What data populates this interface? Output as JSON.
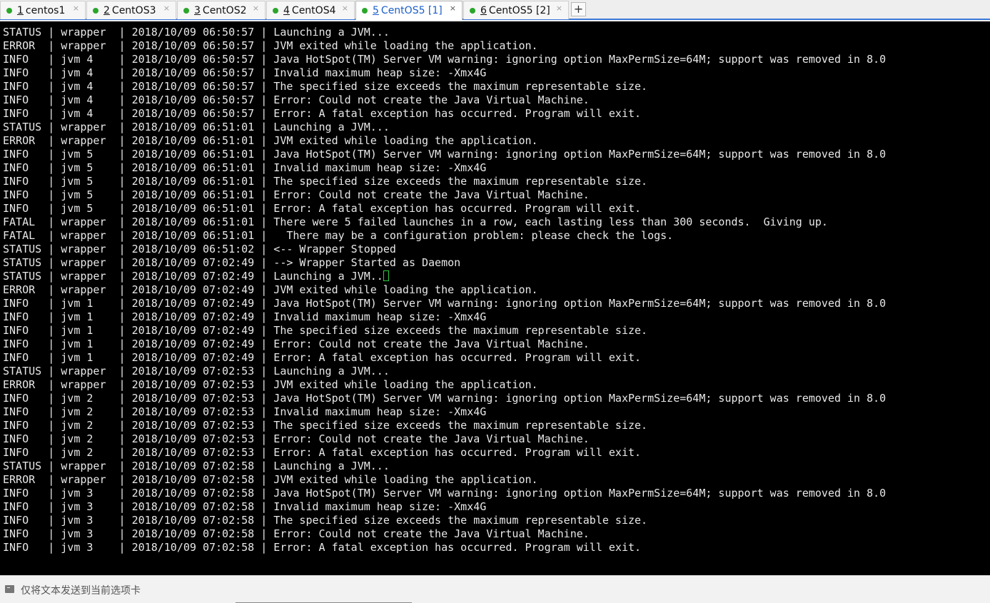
{
  "tabs": [
    {
      "num": "1",
      "label": "centos1",
      "status_color": "#2aa62a",
      "close": "×",
      "active": false
    },
    {
      "num": "2",
      "label": "CentOS3",
      "status_color": "#2aa62a",
      "close": "×",
      "active": false
    },
    {
      "num": "3",
      "label": "CentOS2",
      "status_color": "#2aa62a",
      "close": "×",
      "active": false
    },
    {
      "num": "4",
      "label": "CentOS4",
      "status_color": "#2aa62a",
      "close": "×",
      "active": false
    },
    {
      "num": "5",
      "label": "CentOS5 [1]",
      "status_color": "#2aa62a",
      "close": "×",
      "active": true
    },
    {
      "num": "6",
      "label": "CentOS5 [2]",
      "status_color": "#2aa62a",
      "close": "×",
      "active": false
    }
  ],
  "add_tab_label": "+",
  "colors": {
    "terminal_bg": "#000000",
    "terminal_fg": "#e8e8e8",
    "active_tab_text": "#1a5fc8",
    "tab_underline": "#3c78d8",
    "cursor": "#2ecc40"
  },
  "terminal": {
    "lines": [
      "STATUS | wrapper  | 2018/10/09 06:50:57 | Launching a JVM...",
      "ERROR  | wrapper  | 2018/10/09 06:50:57 | JVM exited while loading the application.",
      "INFO   | jvm 4    | 2018/10/09 06:50:57 | Java HotSpot(TM) Server VM warning: ignoring option MaxPermSize=64M; support was removed in 8.0",
      "INFO   | jvm 4    | 2018/10/09 06:50:57 | Invalid maximum heap size: -Xmx4G",
      "INFO   | jvm 4    | 2018/10/09 06:50:57 | The specified size exceeds the maximum representable size.",
      "INFO   | jvm 4    | 2018/10/09 06:50:57 | Error: Could not create the Java Virtual Machine.",
      "INFO   | jvm 4    | 2018/10/09 06:50:57 | Error: A fatal exception has occurred. Program will exit.",
      "STATUS | wrapper  | 2018/10/09 06:51:01 | Launching a JVM...",
      "ERROR  | wrapper  | 2018/10/09 06:51:01 | JVM exited while loading the application.",
      "INFO   | jvm 5    | 2018/10/09 06:51:01 | Java HotSpot(TM) Server VM warning: ignoring option MaxPermSize=64M; support was removed in 8.0",
      "INFO   | jvm 5    | 2018/10/09 06:51:01 | Invalid maximum heap size: -Xmx4G",
      "INFO   | jvm 5    | 2018/10/09 06:51:01 | The specified size exceeds the maximum representable size.",
      "INFO   | jvm 5    | 2018/10/09 06:51:01 | Error: Could not create the Java Virtual Machine.",
      "INFO   | jvm 5    | 2018/10/09 06:51:01 | Error: A fatal exception has occurred. Program will exit.",
      "FATAL  | wrapper  | 2018/10/09 06:51:01 | There were 5 failed launches in a row, each lasting less than 300 seconds.  Giving up.",
      "FATAL  | wrapper  | 2018/10/09 06:51:01 |   There may be a configuration problem: please check the logs.",
      "STATUS | wrapper  | 2018/10/09 06:51:02 | <-- Wrapper Stopped",
      "STATUS | wrapper  | 2018/10/09 07:02:49 | --> Wrapper Started as Daemon",
      "STATUS | wrapper  | 2018/10/09 07:02:49 | Launching a JVM..",
      "ERROR  | wrapper  | 2018/10/09 07:02:49 | JVM exited while loading the application.",
      "INFO   | jvm 1    | 2018/10/09 07:02:49 | Java HotSpot(TM) Server VM warning: ignoring option MaxPermSize=64M; support was removed in 8.0",
      "INFO   | jvm 1    | 2018/10/09 07:02:49 | Invalid maximum heap size: -Xmx4G",
      "INFO   | jvm 1    | 2018/10/09 07:02:49 | The specified size exceeds the maximum representable size.",
      "INFO   | jvm 1    | 2018/10/09 07:02:49 | Error: Could not create the Java Virtual Machine.",
      "INFO   | jvm 1    | 2018/10/09 07:02:49 | Error: A fatal exception has occurred. Program will exit.",
      "STATUS | wrapper  | 2018/10/09 07:02:53 | Launching a JVM...",
      "ERROR  | wrapper  | 2018/10/09 07:02:53 | JVM exited while loading the application.",
      "INFO   | jvm 2    | 2018/10/09 07:02:53 | Java HotSpot(TM) Server VM warning: ignoring option MaxPermSize=64M; support was removed in 8.0",
      "INFO   | jvm 2    | 2018/10/09 07:02:53 | Invalid maximum heap size: -Xmx4G",
      "INFO   | jvm 2    | 2018/10/09 07:02:53 | The specified size exceeds the maximum representable size.",
      "INFO   | jvm 2    | 2018/10/09 07:02:53 | Error: Could not create the Java Virtual Machine.",
      "INFO   | jvm 2    | 2018/10/09 07:02:53 | Error: A fatal exception has occurred. Program will exit.",
      "STATUS | wrapper  | 2018/10/09 07:02:58 | Launching a JVM...",
      "ERROR  | wrapper  | 2018/10/09 07:02:58 | JVM exited while loading the application.",
      "INFO   | jvm 3    | 2018/10/09 07:02:58 | Java HotSpot(TM) Server VM warning: ignoring option MaxPermSize=64M; support was removed in 8.0",
      "INFO   | jvm 3    | 2018/10/09 07:02:58 | Invalid maximum heap size: -Xmx4G",
      "INFO   | jvm 3    | 2018/10/09 07:02:58 | The specified size exceeds the maximum representable size.",
      "INFO   | jvm 3    | 2018/10/09 07:02:58 | Error: Could not create the Java Virtual Machine.",
      "INFO   | jvm 3    | 2018/10/09 07:02:58 | Error: A fatal exception has occurred. Program will exit."
    ],
    "cursor_line_index": 18
  },
  "send_bar": {
    "icon": "terminal-icon",
    "text": "仅将文本发送到当前选项卡"
  }
}
